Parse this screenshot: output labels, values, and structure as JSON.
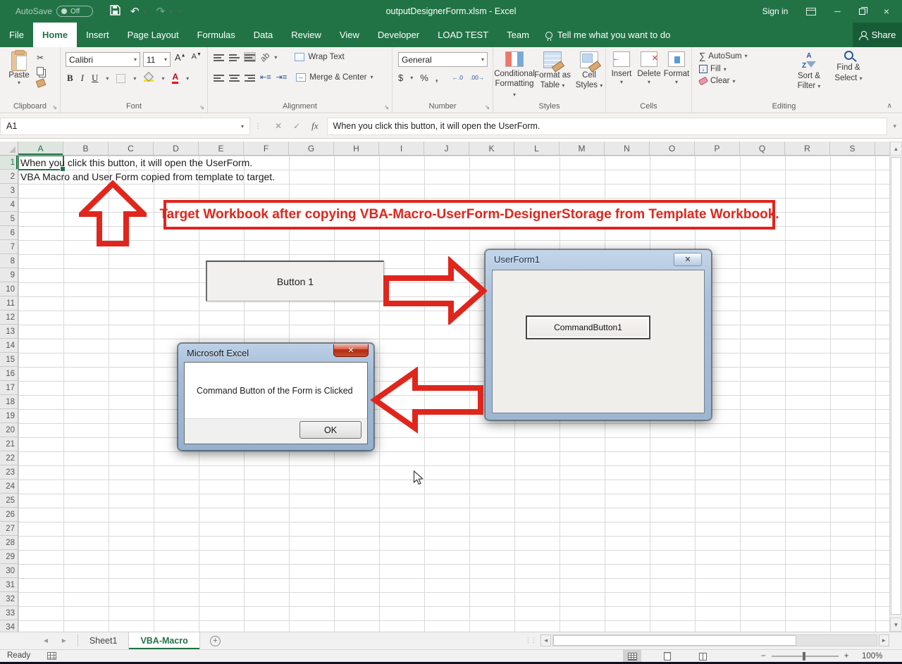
{
  "titlebar": {
    "autosave_label": "AutoSave",
    "autosave_state": "Off",
    "title": "outputDesignerForm.xlsm  -  Excel",
    "sign_in": "Sign in"
  },
  "ribbon_tabs": [
    {
      "label": "File",
      "active": false
    },
    {
      "label": "Home",
      "active": true
    },
    {
      "label": "Insert",
      "active": false
    },
    {
      "label": "Page Layout",
      "active": false
    },
    {
      "label": "Formulas",
      "active": false
    },
    {
      "label": "Data",
      "active": false
    },
    {
      "label": "Review",
      "active": false
    },
    {
      "label": "View",
      "active": false
    },
    {
      "label": "Developer",
      "active": false
    },
    {
      "label": "LOAD TEST",
      "active": false
    },
    {
      "label": "Team",
      "active": false
    }
  ],
  "tell_me": "Tell me what you want to do",
  "share_label": "Share",
  "ribbon": {
    "clipboard": {
      "label": "Clipboard",
      "paste": "Paste"
    },
    "font": {
      "label": "Font",
      "font_name": "Calibri",
      "font_size": "11",
      "bold": "B",
      "italic": "I",
      "underline": "U"
    },
    "alignment": {
      "label": "Alignment",
      "wrap_text": "Wrap Text",
      "merge_center": "Merge & Center"
    },
    "number": {
      "label": "Number",
      "format": "General",
      "currency": "$",
      "percent": "%",
      "comma": ",",
      "inc_dec": "←.0",
      "dec_dec": ".00→"
    },
    "styles": {
      "label": "Styles",
      "conditional_1": "Conditional",
      "conditional_2": "Formatting",
      "format_table_1": "Format as",
      "format_table_2": "Table",
      "cell_styles_1": "Cell",
      "cell_styles_2": "Styles"
    },
    "cells": {
      "label": "Cells",
      "insert": "Insert",
      "delete": "Delete",
      "format": "Format"
    },
    "editing": {
      "label": "Editing",
      "autosum": "AutoSum",
      "fill": "Fill",
      "clear": "Clear",
      "sort_1": "Sort &",
      "sort_2": "Filter",
      "find_1": "Find &",
      "find_2": "Select"
    }
  },
  "formula_bar": {
    "name_box": "A1",
    "formula": "When you click this button, it will open the UserForm."
  },
  "grid": {
    "columns": [
      "A",
      "B",
      "C",
      "D",
      "E",
      "F",
      "G",
      "H",
      "I",
      "J",
      "K",
      "L",
      "M",
      "N",
      "O",
      "P",
      "Q",
      "R",
      "S"
    ],
    "selected_column": "A",
    "row_count": 34,
    "selected_row": 1,
    "cell_texts": [
      {
        "row": 1,
        "text": "When you click this button, it will open the UserForm."
      },
      {
        "row": 2,
        "text": "VBA Macro and User Form copied from template to target."
      }
    ]
  },
  "annotations": {
    "banner_text": "Target Workbook after copying VBA-Macro-UserForm-DesignerStorage from Template Workbook.",
    "accent_red": "#e0261c"
  },
  "sheet_button": {
    "label": "Button 1"
  },
  "userform": {
    "title": "UserForm1",
    "close_glyph": "✕",
    "command_button": "CommandButton1"
  },
  "msgbox": {
    "title": "Microsoft Excel",
    "close_glyph": "✕",
    "message": "Command Button of the Form is Clicked",
    "ok_label": "OK"
  },
  "sheet_tabs": {
    "tabs": [
      {
        "label": "Sheet1",
        "active": false
      },
      {
        "label": "VBA-Macro",
        "active": true
      }
    ]
  },
  "status_bar": {
    "mode": "Ready",
    "zoom_level": "100%"
  }
}
